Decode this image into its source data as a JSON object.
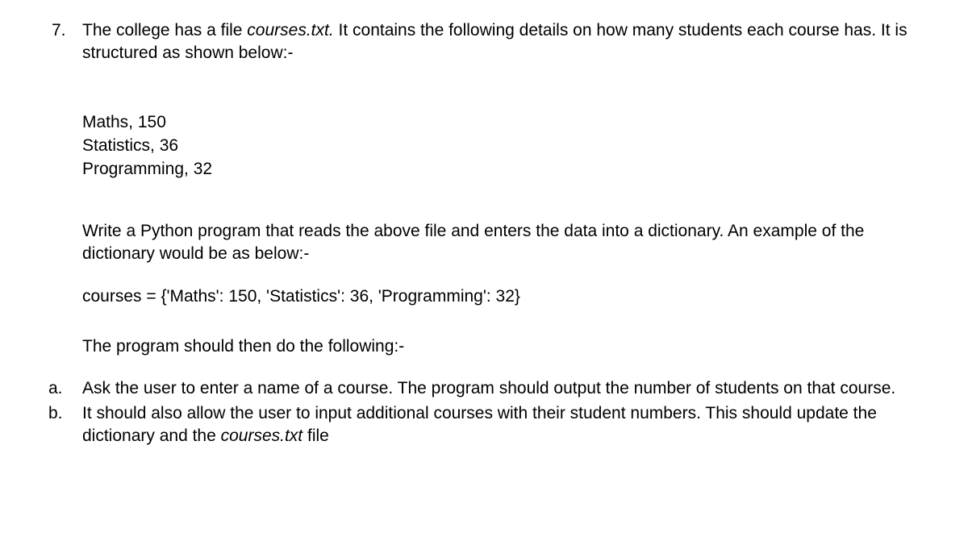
{
  "question": {
    "number": "7.",
    "intro_pre": "The college has a file ",
    "intro_file": "courses.txt.",
    "intro_post": " It contains the following details on how many students each course has. It is structured as shown below:-"
  },
  "file_contents": [
    "Maths, 150",
    "Statistics, 36",
    "Programming, 32"
  ],
  "paragraph_write": "Write a Python program that reads the above file and enters the data into a dictionary. An example of the dictionary would be as below:-",
  "dict_example": "courses = {'Maths': 150, 'Statistics': 36, 'Programming': 32}",
  "paragraph_then": "The program should then do the following:-",
  "subitems": {
    "a": {
      "letter": "a.",
      "text": "Ask the user to enter a name of a course. The program should output the number of students on that course."
    },
    "b": {
      "letter": "b.",
      "text_pre": "It should also allow the user to input additional courses with their student numbers. This should update the dictionary and the ",
      "text_file": "courses.txt",
      "text_post": " file"
    }
  }
}
